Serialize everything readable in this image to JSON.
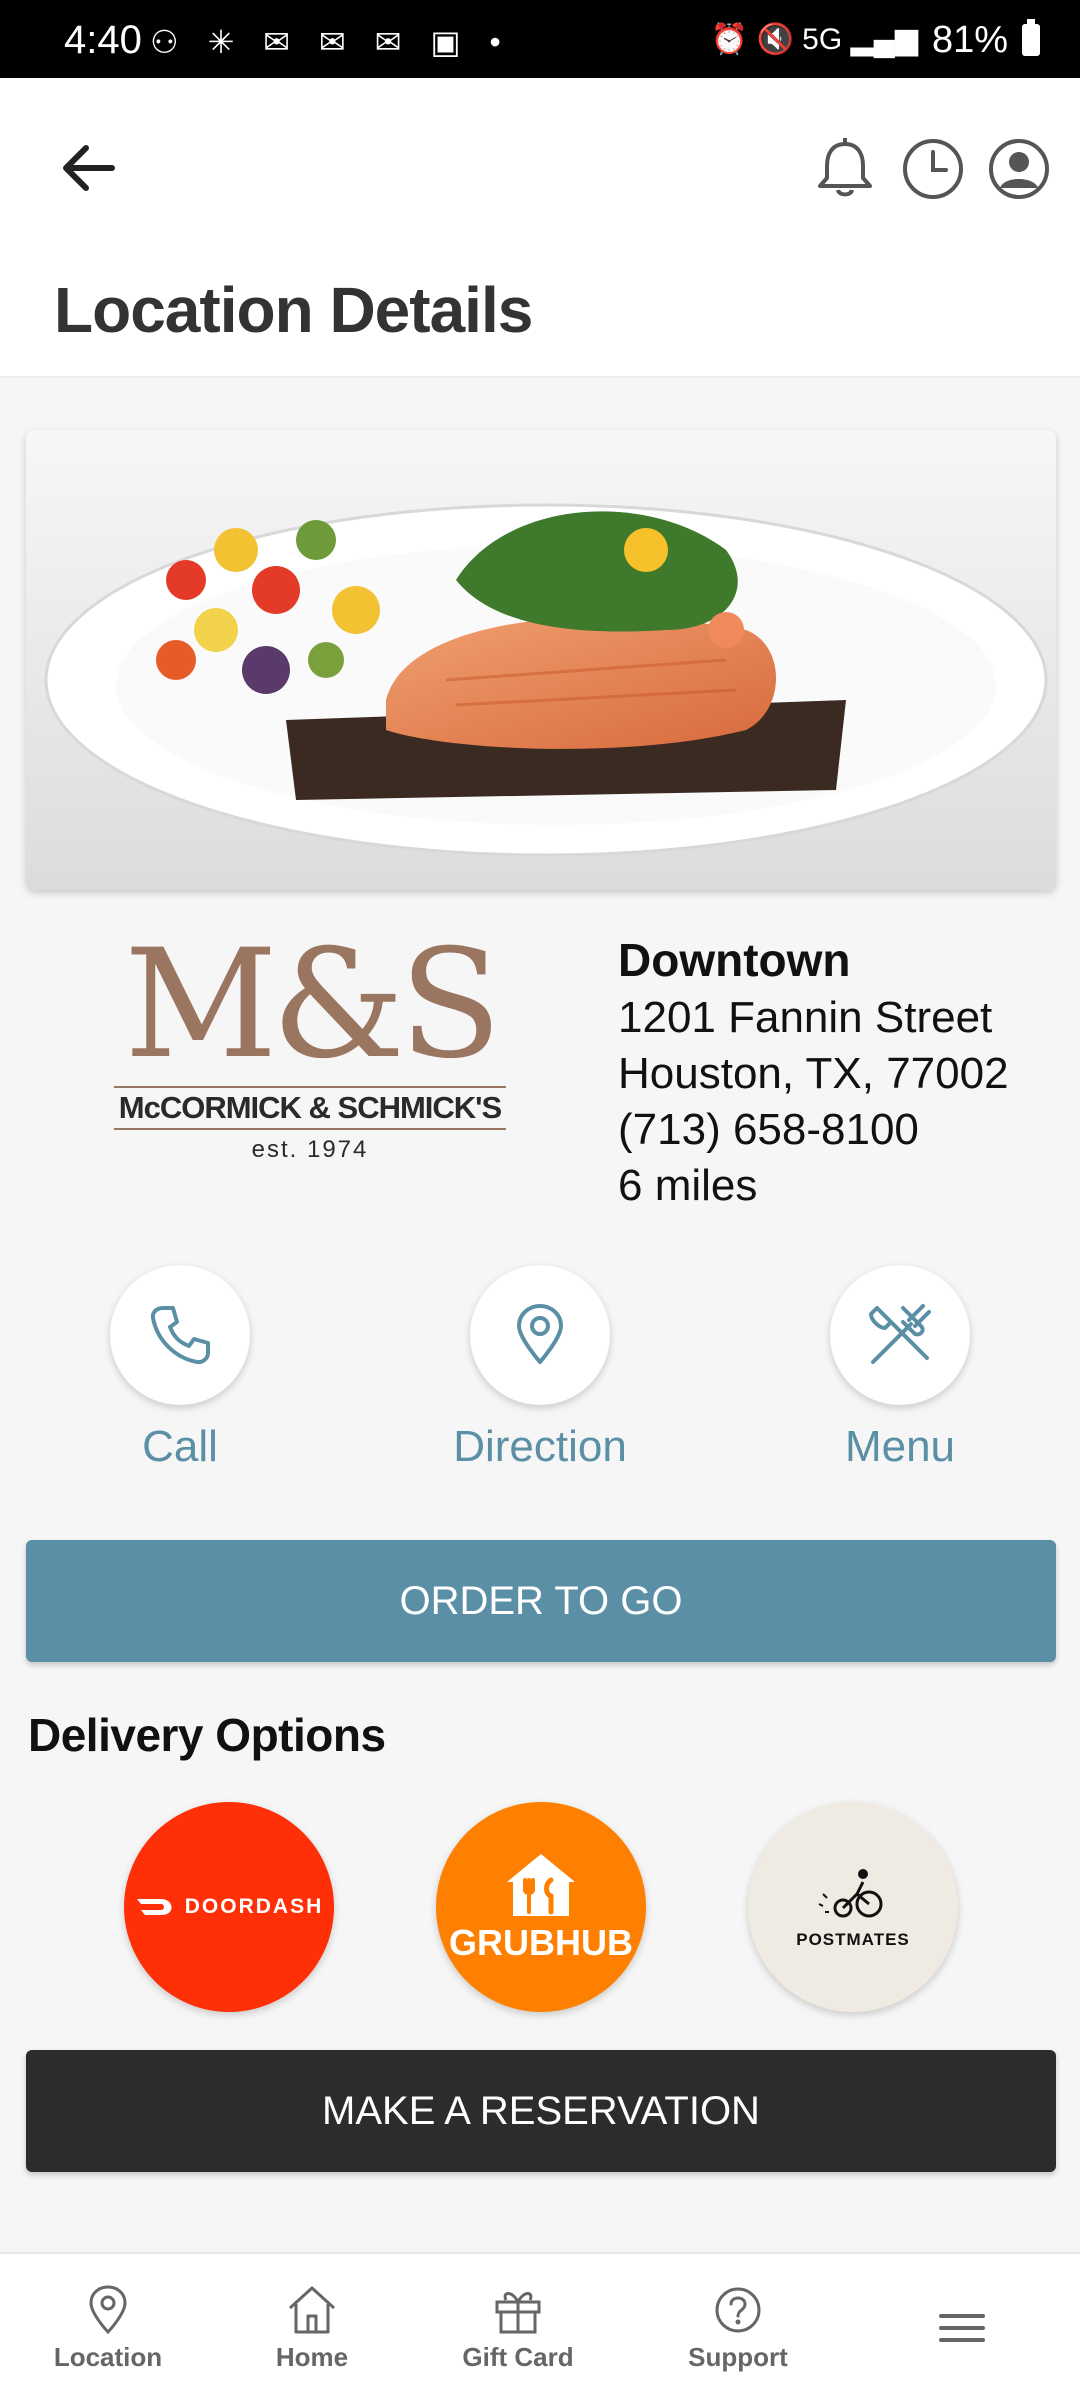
{
  "status_bar": {
    "time": "4:40",
    "left_icons": "⚇ ✳ ✉ ✉ ✉ ▣ •",
    "right_icons": "⏰ 🔇 5G ▂▄▆",
    "battery": "81%"
  },
  "header": {
    "title": "Location Details"
  },
  "location": {
    "name": "Downtown",
    "street": "1201 Fannin Street",
    "city": "Houston, TX, 77002",
    "phone": "(713) 658-8100",
    "distance": "6 miles"
  },
  "logo": {
    "monogram": "M&S",
    "brand": "McCORMICK & SCHMICK'S",
    "est": "est. 1974"
  },
  "actions": {
    "call": "Call",
    "direction": "Direction",
    "menu": "Menu"
  },
  "order_button": "ORDER TO GO",
  "delivery": {
    "title": "Delivery Options",
    "doordash": "DOORDASH",
    "grubhub": "GRUBHUB",
    "postmates": "POSTMATES"
  },
  "reservation_button": "MAKE A RESERVATION",
  "nav": {
    "location": "Location",
    "home": "Home",
    "gift_card": "Gift Card",
    "support": "Support"
  },
  "colors": {
    "accent": "#5a8fa6",
    "dark": "#2e2c2b",
    "doordash": "#ff3008",
    "grubhub": "#ff8000",
    "postmates": "#efebe2",
    "logo_brown": "#9a7560"
  }
}
